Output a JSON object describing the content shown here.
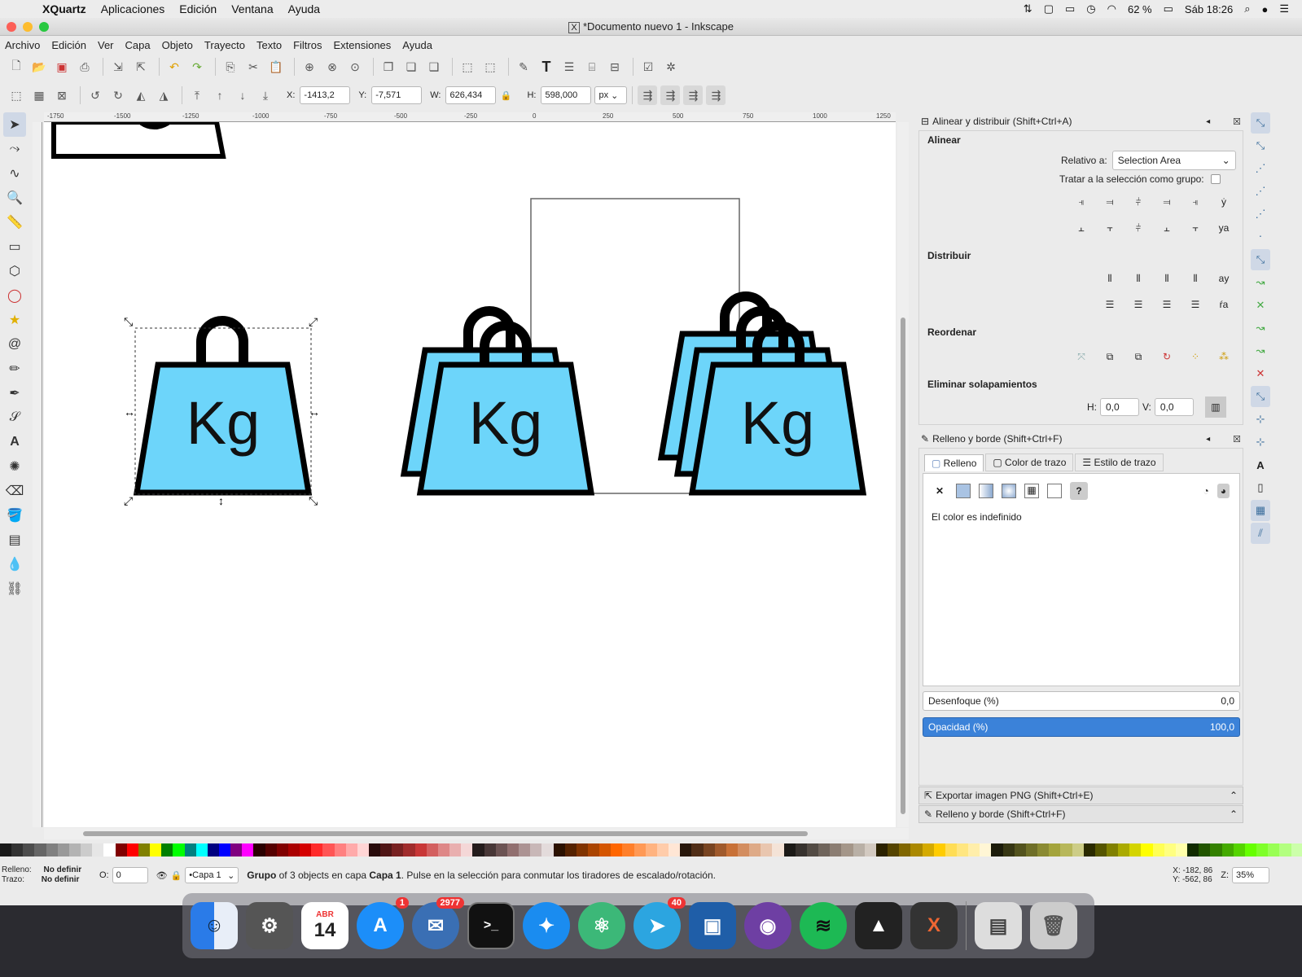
{
  "macbar": {
    "app": "XQuartz",
    "menus": [
      "Aplicaciones",
      "Edición",
      "Ventana",
      "Ayuda"
    ],
    "battery": "62 %",
    "clock": "Sáb 18:26"
  },
  "window": {
    "title": "*Documento nuevo 1 - Inkscape",
    "menus": [
      "Archivo",
      "Edición",
      "Ver",
      "Capa",
      "Objeto",
      "Trayecto",
      "Texto",
      "Filtros",
      "Extensiones",
      "Ayuda"
    ]
  },
  "toolcontrols": {
    "x_label": "X:",
    "x_value": "-1413,2",
    "y_label": "Y:",
    "y_value": "-7,571",
    "w_label": "W:",
    "w_value": "626,434",
    "h_label": "H:",
    "h_value": "598,000",
    "unit": "px"
  },
  "ruler_ticks": [
    "-1750",
    "-1500",
    "-1250",
    "-1000",
    "-750",
    "-500",
    "-250",
    "0",
    "250",
    "500",
    "750",
    "1000",
    "1250"
  ],
  "canvas": {
    "weight_label": "Kg"
  },
  "align_panel": {
    "title": "Alinear y distribuir (Shift+Ctrl+A)",
    "align_heading": "Alinear",
    "relative_label": "Relativo a:",
    "relative_value": "Selection Area",
    "group_label": "Tratar a la selección como grupo:",
    "distribute_heading": "Distribuir",
    "reorder_heading": "Reordenar",
    "overlap_heading": "Eliminar solapamientos",
    "h_label": "H:",
    "h_value": "0,0",
    "v_label": "V:",
    "v_value": "0,0"
  },
  "fill_panel": {
    "title": "Relleno y borde (Shift+Ctrl+F)",
    "tabs": [
      "Relleno",
      "Color de trazo",
      "Estilo de trazo"
    ],
    "undefined_msg": "El color es indefinido",
    "blur_label": "Desenfoque (%)",
    "blur_value": "0,0",
    "opacity_label": "Opacidad (%)",
    "opacity_value": "100,0"
  },
  "collapsed_panels": [
    "Exportar imagen PNG (Shift+Ctrl+E)",
    "Relleno y borde (Shift+Ctrl+F)"
  ],
  "status": {
    "fill_label": "Relleno:",
    "fill_value": "No definir",
    "stroke_label": "Trazo:",
    "stroke_value": "No definir",
    "o_label": "O:",
    "o_value": "0",
    "layer": "•Capa 1",
    "msg_bold1": "Grupo",
    "msg_mid": " of 3 objects en capa ",
    "msg_bold2": "Capa 1",
    "msg_end": ". Pulse en la selección para conmutar los tiradores de escalado/rotación.",
    "coords_x": "X: -182, 86",
    "coords_y": "Y: -562, 86",
    "zoom_label": "Z:",
    "zoom_value": "35%"
  },
  "dock": {
    "calendar_month": "ABR",
    "calendar_day": "14",
    "badge_appstore": "1",
    "badge_thunderbird": "2977",
    "badge_telegram": "40"
  },
  "palette": [
    "#1a1a1a",
    "#333",
    "#4d4d4d",
    "#666",
    "#808080",
    "#999",
    "#b3b3b3",
    "#ccc",
    "#e6e6e6",
    "#fff",
    "#800000",
    "#ff0000",
    "#808000",
    "#ffff00",
    "#008000",
    "#00ff00",
    "#008080",
    "#00ffff",
    "#000080",
    "#0000ff",
    "#800080",
    "#ff00ff",
    "#2b0000",
    "#550000",
    "#800000",
    "#aa0000",
    "#d40000",
    "#ff2a2a",
    "#ff5555",
    "#ff8080",
    "#ffaaaa",
    "#ffd5d5",
    "#280b0b",
    "#501616",
    "#782121",
    "#a02c2c",
    "#c83737",
    "#d35f5f",
    "#de8787",
    "#e9afaf",
    "#f4d7d7",
    "#241c1c",
    "#483737",
    "#6c5353",
    "#916f6f",
    "#ac9393",
    "#c8b7b7",
    "#e3dbdb",
    "#2b1100",
    "#552200",
    "#803300",
    "#aa4400",
    "#d45500",
    "#ff6600",
    "#ff7f2a",
    "#ff9955",
    "#ffb380",
    "#ffccaa",
    "#ffe6d5",
    "#28170b",
    "#502d16",
    "#784421",
    "#a05a2c",
    "#c87137",
    "#d38d5f",
    "#deaa87",
    "#e9c6af",
    "#f4e3d7",
    "#1c1a17",
    "#37322e",
    "#534b44",
    "#6f645b",
    "#8b7d72",
    "#a49689",
    "#b9b0a6",
    "#d3cac1",
    "#2b2200",
    "#554400",
    "#806600",
    "#aa8800",
    "#d4aa00",
    "#ffcc00",
    "#ffdd55",
    "#ffe680",
    "#ffeeaa",
    "#fff6d5",
    "#1c1c0a",
    "#373714",
    "#53531e",
    "#6f6f28",
    "#8a8a32",
    "#a4a43c",
    "#b7b75a",
    "#cdcd87",
    "#2b2b00",
    "#555500",
    "#808000",
    "#aaaa00",
    "#d4d400",
    "#ffff00",
    "#ffff55",
    "#ffff80",
    "#ffffaa",
    "#112b00",
    "#225500",
    "#338000",
    "#44aa00",
    "#55d400",
    "#66ff00",
    "#7fff2a",
    "#99ff55",
    "#b3ff80",
    "#ccffaa"
  ]
}
